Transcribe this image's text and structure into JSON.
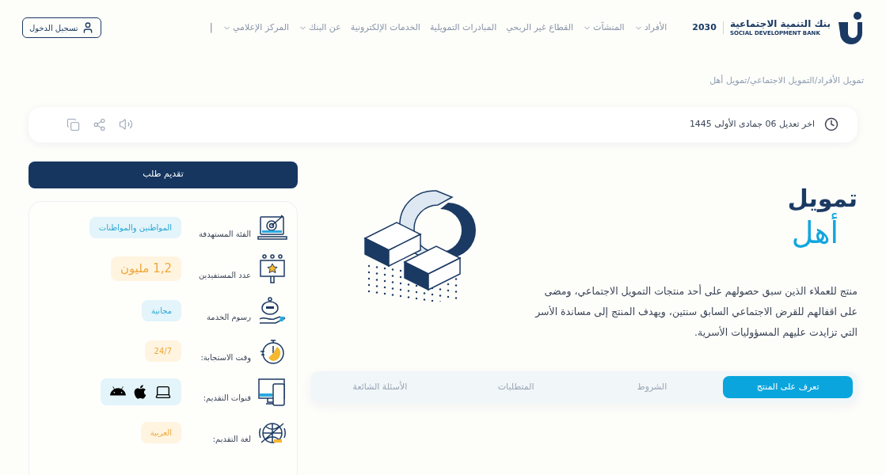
{
  "logo": {
    "arabic": "بنك التنمية الاجتماعية",
    "english": "SOCIAL DEVELOPMENT BANK",
    "vision": "2030"
  },
  "nav": [
    {
      "label": "الأفراد",
      "dropdown": true
    },
    {
      "label": "المنشآت",
      "dropdown": true
    },
    {
      "label": "القطاع غير الربحي",
      "dropdown": false
    },
    {
      "label": "المبادرات التمويلية",
      "dropdown": false
    },
    {
      "label": "الخدمات الإلكترونية",
      "dropdown": false
    },
    {
      "label": "عن البنك",
      "dropdown": true
    },
    {
      "label": "المركز الإعلامي",
      "dropdown": true
    }
  ],
  "separator": "|",
  "login": "تسجيل الدخول",
  "breadcrumb": [
    "تمويل الأفراد",
    "التمويل الاجتماعي",
    "تمويل أهل"
  ],
  "breadcrumb_separator": "/",
  "last_modified": "اخر تعديل 06 جمادى الأولى 1445",
  "apply_button": "تقديم طلب",
  "info": [
    {
      "kind": "text",
      "label": "الفئة المستهدفة",
      "value": "المواطنين والمواطنات",
      "color": "#e3f4fa"
    },
    {
      "kind": "big",
      "label": "عدد المستفيدين",
      "value": "1,2 مليون",
      "color": "#fff4e0"
    },
    {
      "kind": "text",
      "label": "رسوم الخدمة",
      "value": "مجانية",
      "color": "#e3f4fa"
    },
    {
      "kind": "text",
      "label": "وقت الاستجابة:",
      "value": "24/7",
      "color": "#fff4e0"
    },
    {
      "kind": "channels",
      "label": "قنوات التقديم:",
      "color": "#e3f4fa"
    },
    {
      "kind": "text",
      "label": "لغة التقديم:",
      "value": "العربية",
      "color": "#fff4e0"
    }
  ],
  "product": {
    "title_top": "تمويل",
    "title_bottom": "أهل",
    "description": "منتج للعملاء الذين سبق حصولهم على أحد منتجات التمويل الاجتماعي، ومضى على اقفالهم للقرض الاجتماعي السابق سنتين، ويهدف المنتج إلى مساندة الأسر التي تزايدت عليهم المسؤوليات الأسرية."
  },
  "tabs": [
    {
      "label": "تعرف على المنتج",
      "selected": true
    },
    {
      "label": "الشروط",
      "selected": false
    },
    {
      "label": "المتطلبات",
      "selected": false
    },
    {
      "label": "الأسئلة الشائعة",
      "selected": false
    }
  ]
}
